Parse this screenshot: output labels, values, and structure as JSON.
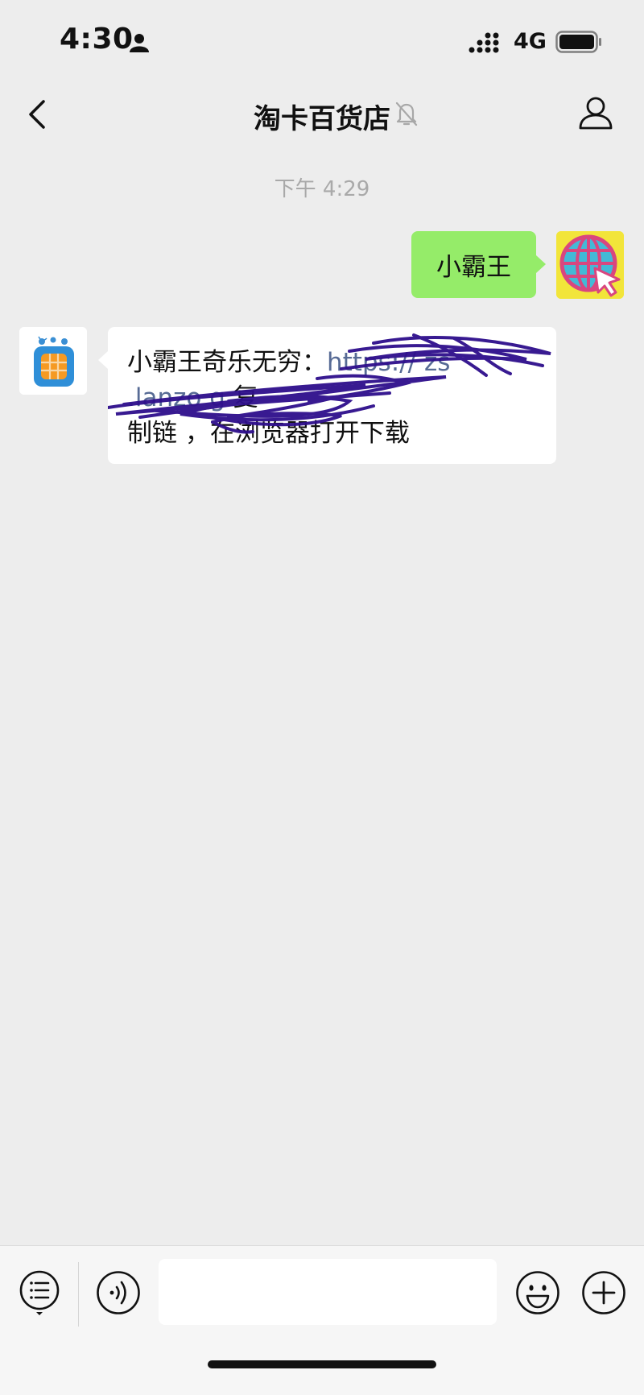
{
  "status_bar": {
    "time": "4:30",
    "network": "4G",
    "icons": [
      "person-icon",
      "signal-icon",
      "battery-icon"
    ]
  },
  "header": {
    "title": "淘卡百货店",
    "icons": [
      "back-icon",
      "mute-bell-icon",
      "profile-icon"
    ]
  },
  "chat": {
    "timestamp": "下午 4:29",
    "messages": [
      {
        "direction": "sent",
        "text": "小霸王",
        "avatar": "globe-cursor-avatar"
      },
      {
        "direction": "received",
        "text_prefix": "小霸王奇乐无穷：",
        "link_fragment_1": "https://",
        "link_fragment_2": "zs",
        "link_fragment_3": ".lanzo",
        "link_fragment_4": "g",
        "text_after_link": " 复",
        "line3_visible_1": "制链",
        "line3_visible_2": "，在",
        "line3_visible_3": "浏览器打开下载",
        "avatar": "sim-card-avatar",
        "redacted": true
      }
    ]
  },
  "input_bar": {
    "icons": [
      "menu-list-icon",
      "voice-icon",
      "emoji-icon",
      "plus-icon"
    ],
    "input_value": ""
  },
  "colors": {
    "background": "#EDEDED",
    "sent_bubble": "#95EC69",
    "received_bubble": "#FFFFFF",
    "link": "#576B95",
    "scribble": "#2E0E8C"
  }
}
